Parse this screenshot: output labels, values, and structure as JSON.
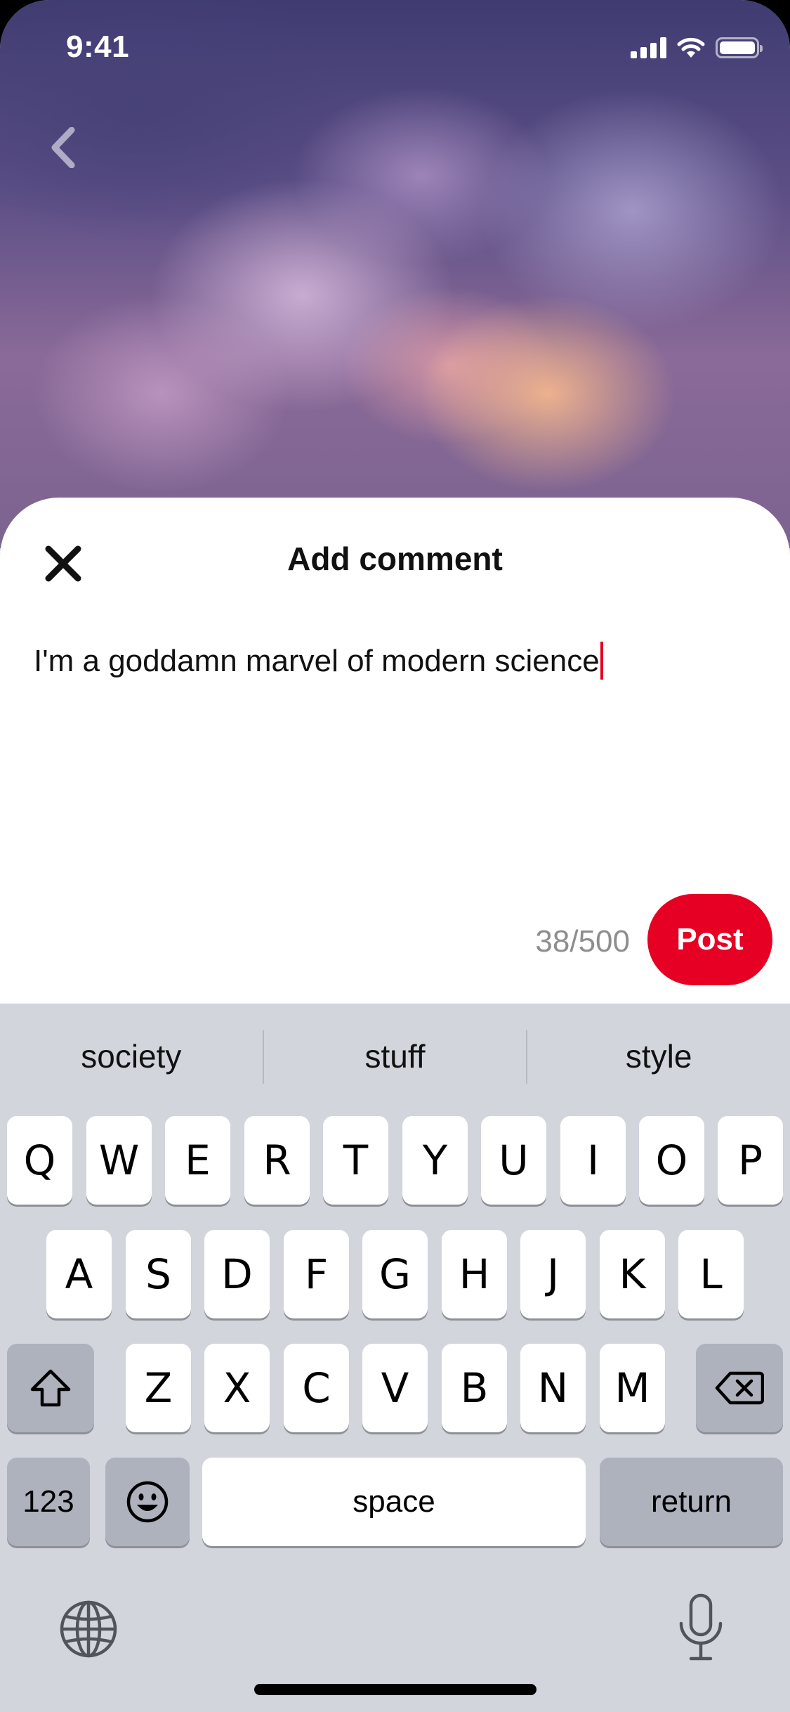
{
  "status_bar": {
    "time": "9:41"
  },
  "sheet": {
    "title": "Add comment",
    "comment_text": "I'm a goddamn marvel of modern science",
    "counter": "38/500",
    "post_label": "Post"
  },
  "keyboard": {
    "suggestions": [
      "society",
      "stuff",
      "style"
    ],
    "row1": [
      "Q",
      "W",
      "E",
      "R",
      "T",
      "Y",
      "U",
      "I",
      "O",
      "P"
    ],
    "row2": [
      "A",
      "S",
      "D",
      "F",
      "G",
      "H",
      "J",
      "K",
      "L"
    ],
    "row3": [
      "Z",
      "X",
      "C",
      "V",
      "B",
      "N",
      "M"
    ],
    "numbers_label": "123",
    "space_label": "space",
    "return_label": "return"
  },
  "colors": {
    "accent": "#e60023",
    "keyboard_bg": "#d2d5dc",
    "key_dark": "#adb2bc"
  }
}
